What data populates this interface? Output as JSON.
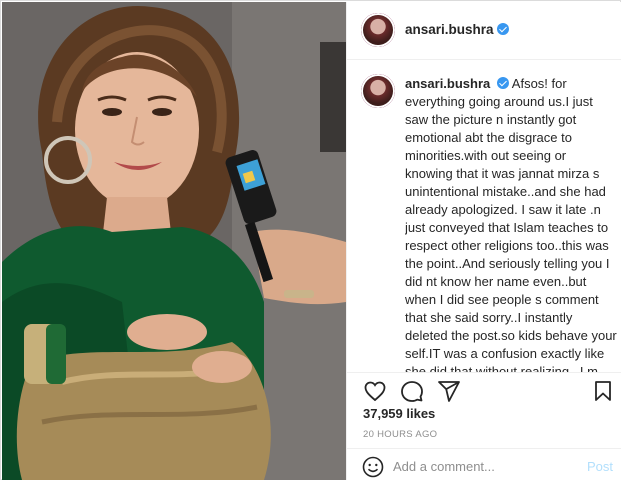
{
  "post": {
    "username": "ansari.bushra",
    "caption_username": "ansari.bushra",
    "caption_text": "Afsos! for everything going around us.I just saw the picture n instantly got emotional abt the disgrace to minorities.with out seeing or knowing that it was jannat mirza s unintentional mistake..and she had already apologized. I saw it late .n just conveyed that Islam teaches to respect other religions too..this was the point..And seriously telling you I did nt know her name even..but when I did see people s comment that she said sorry..I instantly deleted the post.so kids behave your self.IT was a confusion exactly like she did that without realizing ..I m not teaching Islam.But we ve to be just humans and respect humanity..young kids are going to live n enjoy this life longer than us but u ve to respect your elders",
    "likes": "37,959 likes",
    "timestamp": "20 HOURS AGO"
  },
  "comment": {
    "placeholder": "Add a comment...",
    "post_label": "Post"
  },
  "icons": {
    "verified": "verified-badge-icon",
    "like": "heart-icon",
    "comment": "comment-icon",
    "share": "share-icon",
    "save": "bookmark-icon",
    "emoji": "emoji-icon"
  },
  "colors": {
    "verified_blue": "#3897f0",
    "post_button_disabled": "#b2dffc",
    "muted_text": "#8e8e8e",
    "saree_green": "#0f5a2f",
    "saree_gold": "#a68b58"
  }
}
